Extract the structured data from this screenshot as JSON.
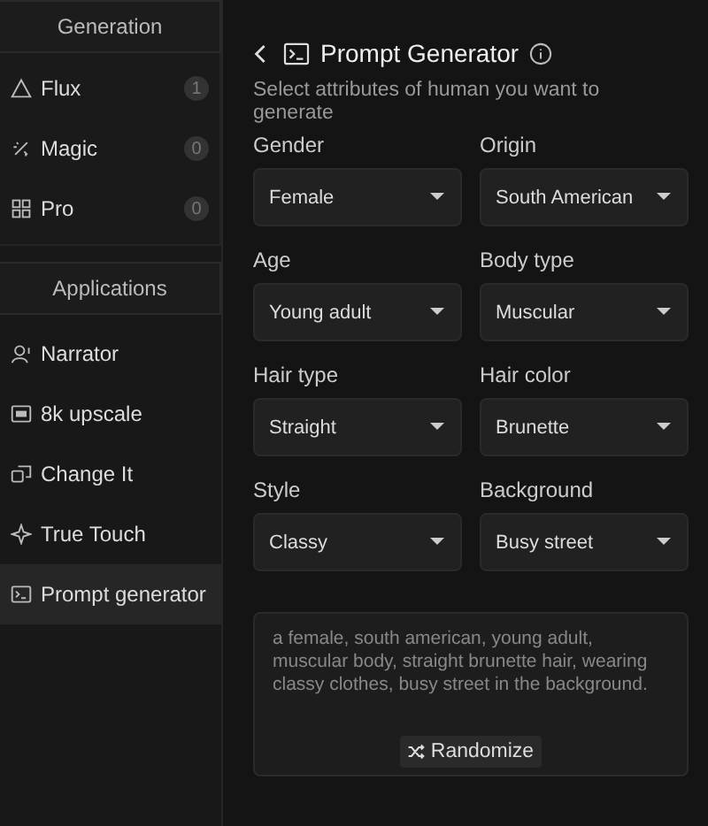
{
  "sidebar": {
    "sections": [
      {
        "title": "Generation",
        "items": [
          {
            "label": "Flux",
            "count": "1",
            "selected": false
          },
          {
            "label": "Magic",
            "count": "0",
            "selected": false
          },
          {
            "label": "Pro",
            "count": "0",
            "selected": false
          }
        ]
      },
      {
        "title": "Applications",
        "items": [
          {
            "label": "Narrator",
            "selected": false
          },
          {
            "label": "8k upscale",
            "selected": false
          },
          {
            "label": "Change It",
            "selected": false
          },
          {
            "label": "True Touch",
            "selected": false
          },
          {
            "label": "Prompt generator",
            "selected": true
          }
        ]
      }
    ]
  },
  "header": {
    "title": "Prompt Generator",
    "subtitle": "Select attributes of human you want to generate"
  },
  "fields": [
    {
      "label": "Gender",
      "value": "Female"
    },
    {
      "label": "Origin",
      "value": "South American"
    },
    {
      "label": "Age",
      "value": "Young adult"
    },
    {
      "label": "Body type",
      "value": "Muscular"
    },
    {
      "label": "Hair type",
      "value": "Straight"
    },
    {
      "label": "Hair color",
      "value": "Brunette"
    },
    {
      "label": "Style",
      "value": "Classy"
    },
    {
      "label": "Background",
      "value": "Busy street"
    }
  ],
  "prompt": {
    "text": "a female, south american, young adult, muscular body, straight brunette hair, wearing classy clothes, busy street in the background.",
    "button": "Randomize"
  }
}
